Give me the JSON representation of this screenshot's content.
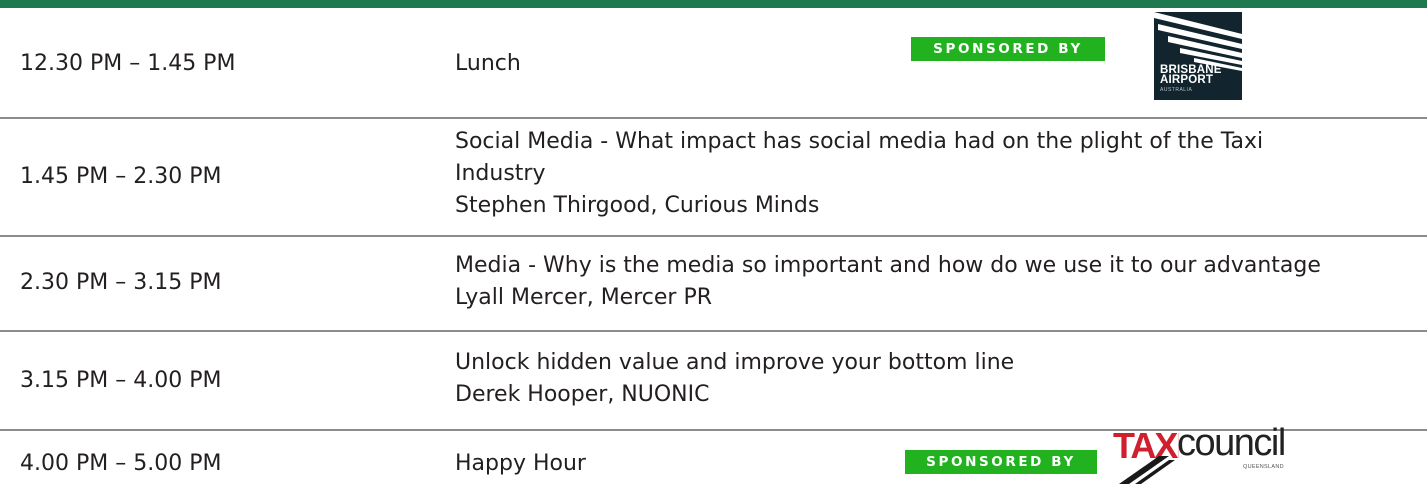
{
  "agenda": {
    "rows": [
      {
        "time": "12.30 PM – 1.45 PM",
        "lines": [
          "Lunch"
        ],
        "sponsor_label": "SPONSORED BY",
        "sponsor_logo": {
          "line1": "BRISBANE",
          "line2": "AIRPORT",
          "line3": "AUSTRALIA"
        }
      },
      {
        "time": "1.45 PM – 2.30 PM",
        "lines": [
          "Social Media - What impact has social media had on the plight  of the Taxi",
          "Industry",
          "Stephen Thirgood, Curious Minds"
        ]
      },
      {
        "time": "2.30 PM – 3.15 PM",
        "lines": [
          "Media - Why is the media so important and how do we use it to our advantage",
          "Lyall Mercer, Mercer PR"
        ]
      },
      {
        "time": "3.15 PM – 4.00 PM",
        "lines": [
          "Unlock hidden value and improve your bottom line",
          "Derek Hooper, NUONIC"
        ]
      },
      {
        "time": "4.00 PM – 5.00 PM",
        "lines": [
          "Happy Hour"
        ],
        "sponsor_label": "SPONSORED BY",
        "sponsor_logo": {
          "word_a": "TAXI",
          "word_b": "council",
          "word_c": "QUEENSLAND"
        }
      }
    ]
  },
  "colors": {
    "header_bar": "#1e7a4e",
    "sponsor_badge": "#22b21f",
    "divider": "#8c8c8c",
    "text": "#231f20",
    "airport_logo_bg": "#12252f",
    "taxi_red": "#d0202e"
  },
  "icons": [
    "brisbane-airport-logo",
    "taxi-council-queensland-logo"
  ]
}
